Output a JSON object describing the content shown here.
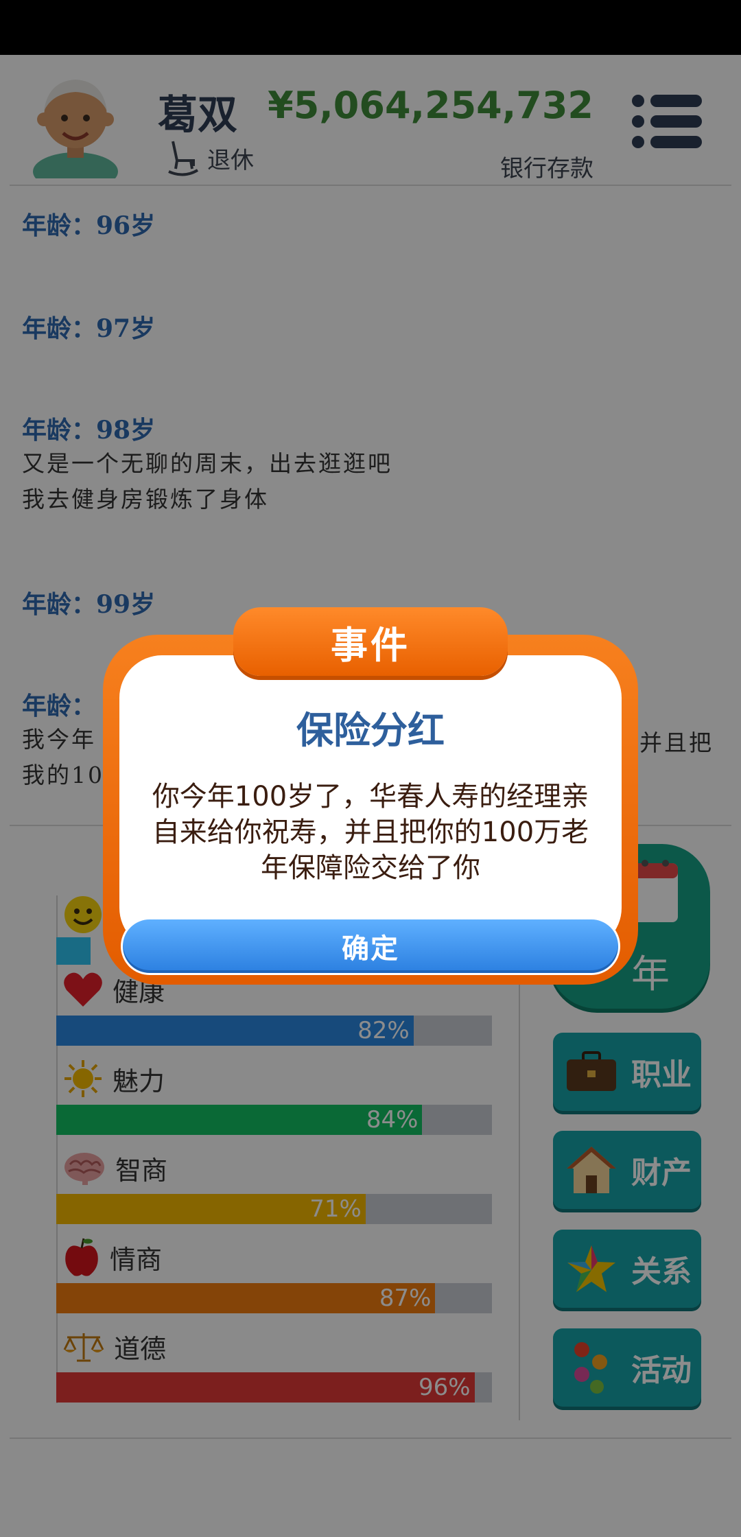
{
  "header": {
    "name": "葛双",
    "status": "退休",
    "money": "¥5,064,254,732",
    "money_label": "银行存款"
  },
  "log": [
    {
      "age": "年龄：96岁",
      "lines": []
    },
    {
      "age": "年龄：97岁",
      "lines": []
    },
    {
      "age": "年龄：98岁",
      "lines": [
        "又是一个无聊的周末，出去逛逛吧",
        "我去健身房锻炼了身体"
      ]
    },
    {
      "age": "年龄：99岁",
      "lines": []
    },
    {
      "age": "年龄：",
      "lines": [
        "我今年",
        "我的10"
      ],
      "line_tail": "并且把"
    }
  ],
  "stats": [
    {
      "label": "健康",
      "value": "82%",
      "fraction": 0.82,
      "color": "#2a88e0",
      "icon": "heart-icon"
    },
    {
      "label": "魅力",
      "value": "84%",
      "fraction": 0.84,
      "color": "#13c063",
      "icon": "sun-icon"
    },
    {
      "label": "智商",
      "value": "71%",
      "fraction": 0.71,
      "color": "#f4b800",
      "icon": "brain-icon"
    },
    {
      "label": "情商",
      "value": "87%",
      "fraction": 0.87,
      "color": "#f07c10",
      "icon": "apple-icon"
    },
    {
      "label": "道德",
      "value": "96%",
      "fraction": 0.96,
      "color": "#e23a38",
      "icon": "scale-icon"
    }
  ],
  "top_stat": {
    "color": "#2ec4f0",
    "icon": "smiley-icon"
  },
  "next_year_label": "年",
  "side_buttons": [
    {
      "label": "职业",
      "icon": "briefcase-icon"
    },
    {
      "label": "财产",
      "icon": "house-icon"
    },
    {
      "label": "关系",
      "icon": "star-icon"
    },
    {
      "label": "活动",
      "icon": "activity-icon"
    }
  ],
  "modal": {
    "header": "事件",
    "title": "保险分红",
    "body": "你今年100岁了，华春人寿的经理亲自来给你祝寿，并且把你的100万老年保障险交给了你",
    "ok": "确定"
  }
}
